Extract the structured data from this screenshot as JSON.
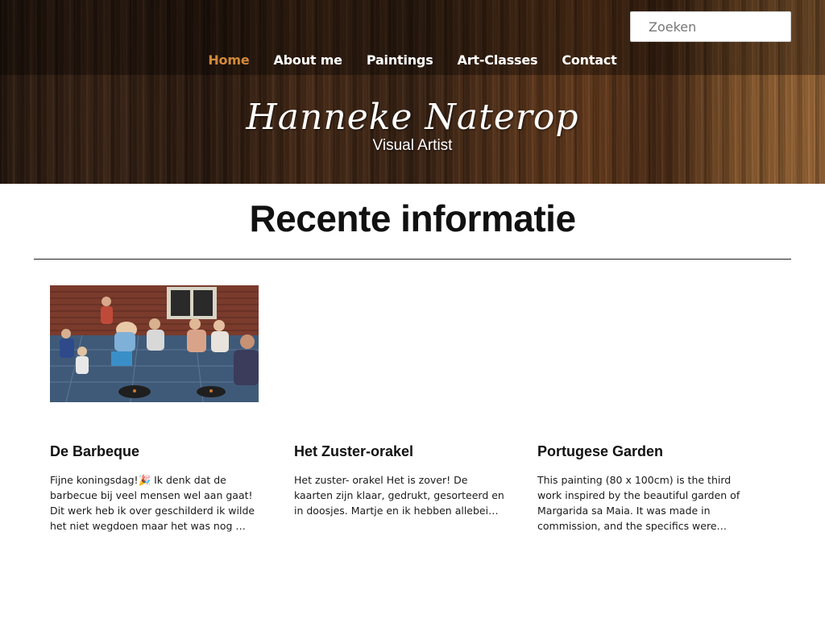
{
  "search": {
    "placeholder": "Zoeken"
  },
  "nav": {
    "items": [
      {
        "label": "Home"
      },
      {
        "label": "About me"
      },
      {
        "label": "Paintings"
      },
      {
        "label": "Art-Classes"
      },
      {
        "label": "Contact"
      }
    ]
  },
  "brand": {
    "name": "Hanneke Naterop",
    "tagline": "Visual Artist"
  },
  "main": {
    "title": "Recente informatie",
    "posts": [
      {
        "title": "De Barbeque",
        "excerpt": "Fijne koningsdag!🎉 Ik denk dat de barbecue bij veel mensen wel aan gaat! Dit werk heb ik over geschilderd ik wilde het niet wegdoen maar het was nog …"
      },
      {
        "title": "Het Zuster-orakel",
        "excerpt": "Het zuster- orakel Het is zover! De kaarten zijn klaar, gedrukt, gesorteerd en in doosjes. Martje en ik hebben allebei…"
      },
      {
        "title": "Portugese Garden",
        "excerpt": "This painting (80 x 100cm) is the third work inspired by the beautiful garden of Margarida sa Maia. It was made in commission, and the specifics were…"
      }
    ]
  },
  "colors": {
    "nav_active": "#d28a3a",
    "nav_text": "#ffffff",
    "divider": "#222222"
  }
}
